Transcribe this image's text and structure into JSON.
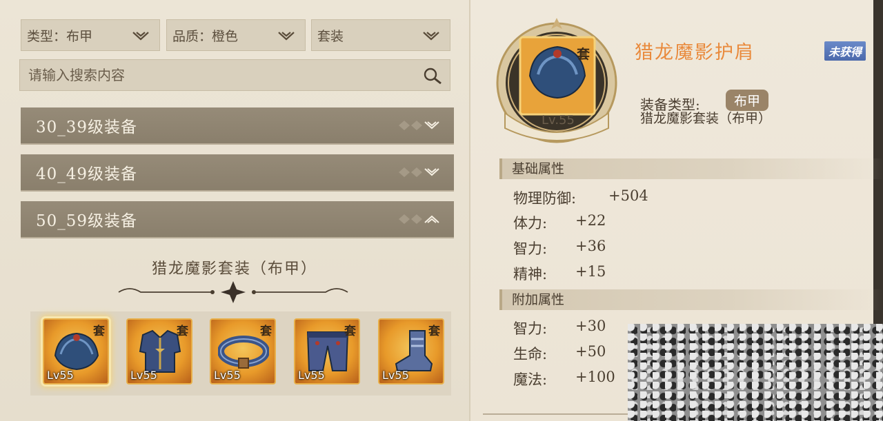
{
  "filters": {
    "type_label": "类型：布甲",
    "quality_label": "品质：橙色",
    "set_label": "套装"
  },
  "search": {
    "placeholder": "请输入搜索内容"
  },
  "categories": [
    {
      "label": "30_39级装备",
      "expanded": false
    },
    {
      "label": "40_49级装备",
      "expanded": false
    },
    {
      "label": "50_59级装备",
      "expanded": true
    }
  ],
  "set": {
    "title": "猎龙魔影套装（布甲）",
    "items": [
      {
        "icon": "shoulder-armor-icon",
        "badge": "套",
        "level": "Lv55",
        "selected": true
      },
      {
        "icon": "chest-armor-icon",
        "badge": "套",
        "level": "Lv55",
        "selected": false
      },
      {
        "icon": "belt-icon",
        "badge": "套",
        "level": "Lv55",
        "selected": false
      },
      {
        "icon": "pants-icon",
        "badge": "套",
        "level": "Lv55",
        "selected": false
      },
      {
        "icon": "boots-icon",
        "badge": "套",
        "level": "Lv55",
        "selected": false
      }
    ]
  },
  "detail": {
    "name": "猎龙魔影护肩",
    "status": "未获得",
    "emblem_badge": "套",
    "level": "Lv.55",
    "type_label": "装备类型:",
    "type_value": "布甲",
    "set_desc": "猎龙魔影套装（布甲）",
    "base_title": "基础属性",
    "base": [
      {
        "k": "物理防御:",
        "v": "+504"
      },
      {
        "k": "体力:",
        "v": "+22"
      },
      {
        "k": "智力:",
        "v": "+36"
      },
      {
        "k": "精神:",
        "v": "+15"
      }
    ],
    "extra_title": "附加属性",
    "extra": [
      {
        "k": "智力:",
        "v": "+30"
      },
      {
        "k": "生命:",
        "v": "+50"
      },
      {
        "k": "魔法:",
        "v": "+100"
      }
    ]
  },
  "colors": {
    "name_orange": "#e98a3c",
    "badge_blue": "#5676b8",
    "row_bar": "#8e8370"
  }
}
